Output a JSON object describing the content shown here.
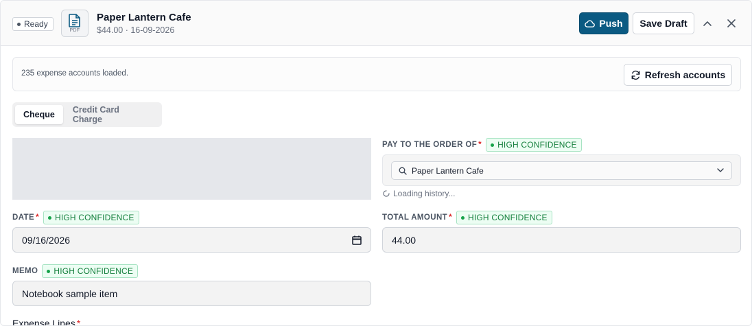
{
  "header": {
    "status": "Ready",
    "file_type": "PDF",
    "title": "Paper Lantern Cafe",
    "subtitle": "$44.00 · 16-09-2026",
    "push_label": "Push",
    "save_draft_label": "Save Draft"
  },
  "accounts": {
    "status_text": "235 expense accounts loaded.",
    "refresh_label": "Refresh accounts"
  },
  "tabs": [
    {
      "label": "Cheque",
      "active": true
    },
    {
      "label": "Credit Card Charge",
      "active": false
    }
  ],
  "confidence_label": "HIGH CONFIDENCE",
  "payee": {
    "label": "PAY TO THE ORDER OF",
    "value": "Paper Lantern Cafe",
    "loading_text": "Loading history..."
  },
  "date": {
    "label": "DATE",
    "value": "09/16/2026"
  },
  "total": {
    "label": "TOTAL AMOUNT",
    "value": "44.00"
  },
  "memo": {
    "label": "MEMO",
    "value": "Notebook sample item"
  },
  "expense_lines": {
    "label": "Expense Lines"
  },
  "colors": {
    "primary": "#0b5a82",
    "confidence_green": "#15803d",
    "required_red": "#dc2626"
  }
}
